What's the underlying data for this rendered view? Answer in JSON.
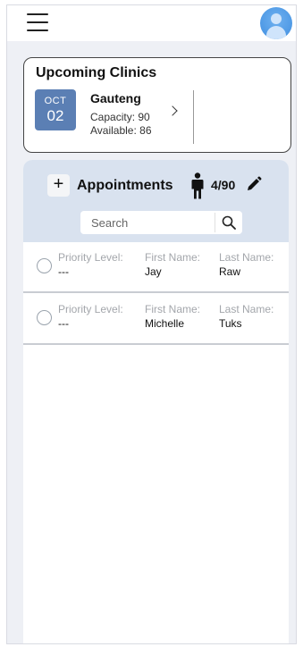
{
  "clinics": {
    "title": "Upcoming Clinics",
    "card": {
      "month": "OCT",
      "day": "02",
      "name": "Gauteng",
      "capacity": "Capacity: 90",
      "available": "Available: 86"
    }
  },
  "appointments": {
    "title": "Appointments",
    "add_label": "+",
    "count": "4/90",
    "search": {
      "placeholder": "Search",
      "value": ""
    },
    "columns": {
      "priority": "Priority Level:",
      "first": "First Name:",
      "last": "Last Name:"
    },
    "rows": [
      {
        "priority": "---",
        "first": "Jay",
        "last": "Raw"
      },
      {
        "priority": "---",
        "first": "Michelle",
        "last": "Tuks"
      }
    ]
  },
  "colors": {
    "accent": "#5b7fb4",
    "header_bg": "#d9e2ef",
    "page_bg": "#eef0f5"
  }
}
